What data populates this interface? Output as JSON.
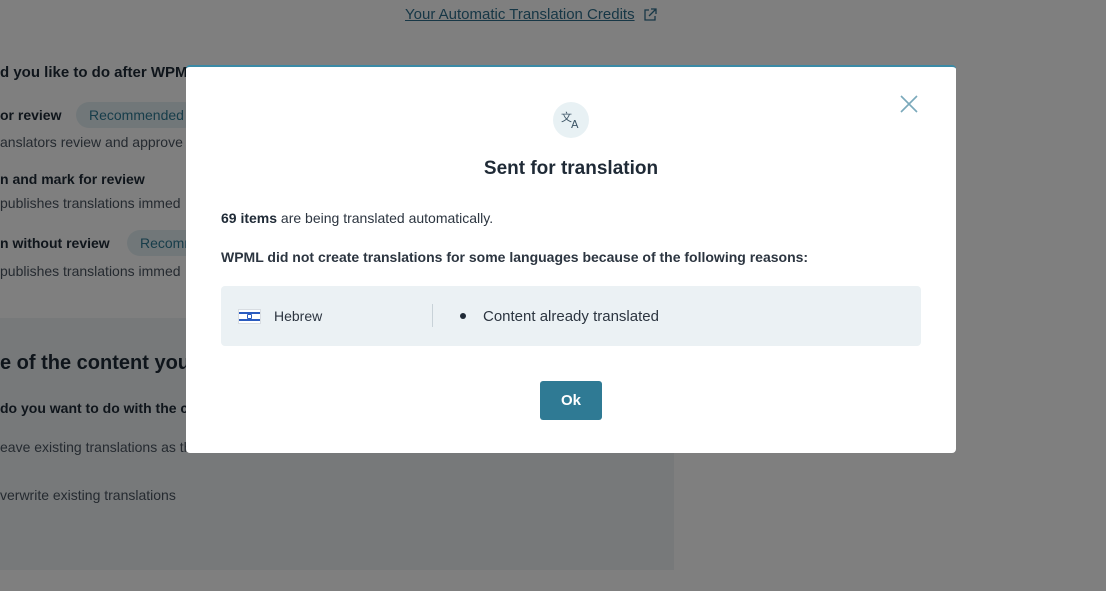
{
  "background": {
    "credits_link": "Your Automatic Translation Credits",
    "question": "d you like to do after WPM",
    "options": [
      {
        "title": "or review",
        "badge": "Recommended",
        "desc": "anslators review and approve"
      },
      {
        "title": "n and mark for review",
        "desc": "publishes translations immed"
      },
      {
        "title": "n without review",
        "badge": "Recomm",
        "desc": "publishes translations immed"
      }
    ],
    "panel": {
      "title": "e of the content you w",
      "question": "do you want to do with the co",
      "options": [
        "eave existing translations as th",
        "verwrite existing translations"
      ]
    }
  },
  "modal": {
    "title": "Sent for translation",
    "summary": {
      "count": "69 items",
      "text": " are being translated automatically."
    },
    "reason_intro": "WPML did not create translations for some languages because of the following reasons:",
    "reasons": [
      {
        "language": "Hebrew",
        "reason": "Content already translated"
      }
    ],
    "ok_label": "Ok",
    "icons": {
      "header": "translate-icon",
      "close": "close-icon",
      "flag": "israel-flag-icon"
    }
  }
}
